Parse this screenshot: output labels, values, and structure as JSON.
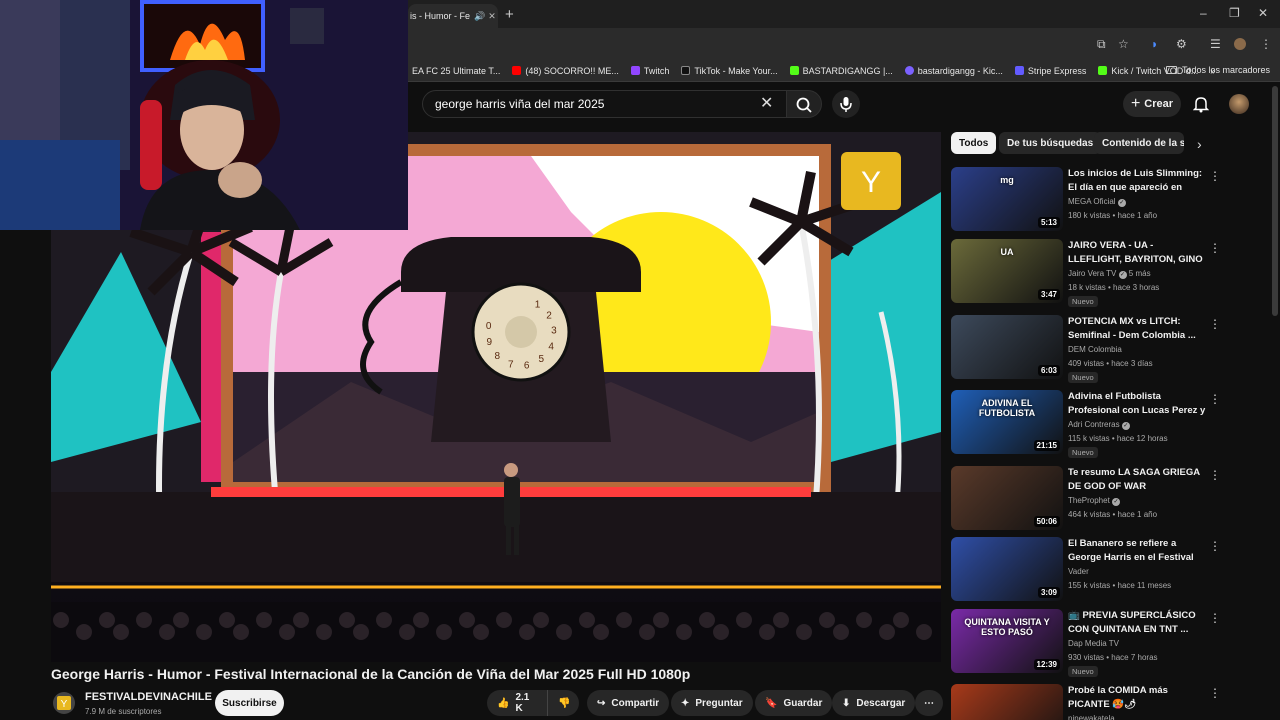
{
  "browser": {
    "tab_title": "is - Humor - Fe",
    "new_tab_icon": "plus-icon",
    "bookmarks": [
      {
        "label": "EA FC 25 Ultimate T...",
        "color": "#2a2a2a"
      },
      {
        "label": "(48) SOCORRO!! ME...",
        "color": "#ff0000"
      },
      {
        "label": "Twitch",
        "color": "#9146ff"
      },
      {
        "label": "TikTok - Make Your...",
        "color": "#000000"
      },
      {
        "label": "BASTARDIGANGG |...",
        "color": "#53fc18"
      },
      {
        "label": "bastardigangg - Kic...",
        "color": "#7b61ff"
      },
      {
        "label": "Stripe Express",
        "color": "#635bff"
      },
      {
        "label": "Kick / Twitch VOD d...",
        "color": "#53fc18"
      }
    ],
    "all_bookmarks": "Todos los marcadores"
  },
  "header": {
    "search_value": "george harris viña del mar 2025",
    "create_label": "Crear"
  },
  "video": {
    "title": "George Harris - Humor - Festival Internacional de la Canción de Viña del Mar 2025 Full HD 1080p",
    "channel": "FESTIVALDEVINACHILE",
    "subscribers": "7.9 M de suscriptores",
    "subscribe_label": "Suscribirse",
    "likes": "2.1 K",
    "share_label": "Compartir",
    "ask_label": "Preguntar",
    "save_label": "Guardar",
    "download_label": "Descargar",
    "dial_numbers": [
      "1",
      "2",
      "3",
      "4",
      "5",
      "6",
      "7",
      "8",
      "9",
      "0"
    ]
  },
  "chips": [
    "Todos",
    "De tus búsquedas",
    "Contenido de la ser"
  ],
  "recommendations": [
    {
      "title": "Los inicios de Luis Slimming: El día en que apareció en Coliseo...",
      "channel": "MEGA Oficial",
      "verified": true,
      "meta": "180 k vistas • hace 1 año",
      "duration": "5:13",
      "badge": "",
      "thumb_color": "#2b3f8a",
      "thumb_text": "mg"
    },
    {
      "title": "JAIRO VERA - UA - LLEFLIGHT, BAYRITON, GINO MELLA, KIN...",
      "channel": "Jairo Vera TV",
      "verified": true,
      "channel_extra": "5 más",
      "meta": "18 k vistas • hace 3 horas",
      "duration": "3:47",
      "badge": "Nuevo",
      "thumb_color": "#6b6a3a",
      "thumb_text": "UA"
    },
    {
      "title": "POTENCIA MX vs LITCH: Semifinal - Dem Colombia ...",
      "channel": "DEM Colombia",
      "verified": false,
      "meta": "409 vistas • hace 3 días",
      "duration": "6:03",
      "badge": "Nuevo",
      "thumb_color": "#3d4a5c",
      "thumb_text": ""
    },
    {
      "title": "Adivina el Futbolista Profesional con Lucas Perez y ...",
      "channel": "Adri Contreras",
      "verified": true,
      "meta": "115 k vistas • hace 12 horas",
      "duration": "21:15",
      "badge": "Nuevo",
      "thumb_color": "#1f5fb8",
      "thumb_text": "ADIVINA EL FUTBOLISTA"
    },
    {
      "title": "Te resumo LA SAGA GRIEGA DE GOD OF WAR",
      "channel": "TheProphet",
      "verified": true,
      "meta": "464 k vistas • hace 1 año",
      "duration": "50:06",
      "badge": "",
      "thumb_color": "#5a3a2a",
      "thumb_text": ""
    },
    {
      "title": "El Bananero se refiere a George Harris en el Festival de Viña ...",
      "channel": "Vader",
      "verified": false,
      "meta": "155 k vistas • hace 11 meses",
      "duration": "3:09",
      "badge": "",
      "thumb_color": "#2f4fa8",
      "thumb_text": ""
    },
    {
      "title": "📺 PREVIA SUPERCLÁSICO CON QUINTANA EN TNT ...",
      "channel": "Dap Media TV",
      "verified": false,
      "meta": "930 vistas • hace 7 horas",
      "duration": "12:39",
      "badge": "Nuevo",
      "thumb_color": "#7a2aa8",
      "thumb_text": "QUINTANA VISITA Y ESTO PASÓ"
    },
    {
      "title": "Probé la COMIDA más PICANTE 🥵🌶",
      "channel": "ninewakatela",
      "verified": false,
      "meta": "",
      "duration": "",
      "badge": "",
      "thumb_color": "#a83a1a",
      "thumb_text": ""
    }
  ]
}
